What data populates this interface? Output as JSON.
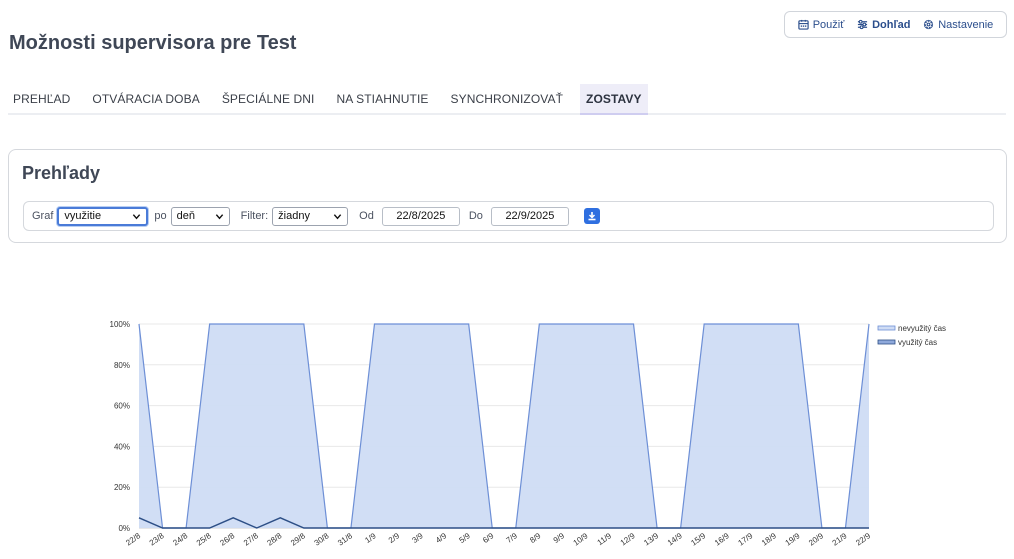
{
  "page": {
    "title": "Možnosti supervisora pre Test"
  },
  "top_actions": [
    {
      "label": "Použiť",
      "icon": "calendar-icon"
    },
    {
      "label": "Dohľad",
      "icon": "sliders-icon",
      "active": true
    },
    {
      "label": "Nastavenie",
      "icon": "gear-icon"
    }
  ],
  "tabs": [
    {
      "label": "PREHĽAD"
    },
    {
      "label": "OTVÁRACIA DOBA"
    },
    {
      "label": "ŠPECIÁLNE DNI"
    },
    {
      "label": "NA STIAHNUTIE"
    },
    {
      "label": "SYNCHRONIZOVAŤ"
    },
    {
      "label": "ZOSTAVY",
      "active": true
    }
  ],
  "panel": {
    "title": "Prehľady",
    "graf_label": "Graf",
    "graf_value": "využitie",
    "po_label": "po",
    "po_value": "deň",
    "filter_label": "Filter:",
    "filter_value": "žiadny",
    "od_label": "Od",
    "od_value": "22/8/2025",
    "do_label": "Do",
    "do_value": "22/9/2025",
    "download_icon": "download-icon"
  },
  "colors": {
    "accent": "#2f6fe0",
    "link": "#2b4e8c",
    "unused_fill": "#cfdcf4",
    "unused_line": "#6d8fd6",
    "used_line": "#2d4f86"
  },
  "chart_data": {
    "type": "area",
    "categories": [
      "22/8",
      "23/8",
      "24/8",
      "25/8",
      "26/8",
      "27/8",
      "28/8",
      "29/8",
      "30/8",
      "31/8",
      "1/9",
      "2/9",
      "3/9",
      "4/9",
      "5/9",
      "6/9",
      "7/9",
      "8/9",
      "9/9",
      "10/9",
      "11/9",
      "12/9",
      "13/9",
      "14/9",
      "15/9",
      "16/9",
      "17/9",
      "18/9",
      "19/9",
      "20/9",
      "21/9",
      "22/9"
    ],
    "ylim": [
      0,
      100
    ],
    "yticks": [
      "0%",
      "20%",
      "40%",
      "60%",
      "80%",
      "100%"
    ],
    "grid": true,
    "legend_position": "right",
    "series": [
      {
        "name": "nevyužitý čas",
        "values": [
          100,
          0,
          0,
          100,
          100,
          100,
          100,
          100,
          0,
          0,
          100,
          100,
          100,
          100,
          100,
          0,
          0,
          100,
          100,
          100,
          100,
          100,
          0,
          0,
          100,
          100,
          100,
          100,
          100,
          0,
          0,
          100
        ]
      },
      {
        "name": "využitý čas",
        "values": [
          5,
          0,
          0,
          0,
          5,
          0,
          5,
          0,
          0,
          0,
          0,
          0,
          0,
          0,
          0,
          0,
          0,
          0,
          0,
          0,
          0,
          0,
          0,
          0,
          0,
          0,
          0,
          0,
          0,
          0,
          0,
          0
        ]
      }
    ]
  }
}
